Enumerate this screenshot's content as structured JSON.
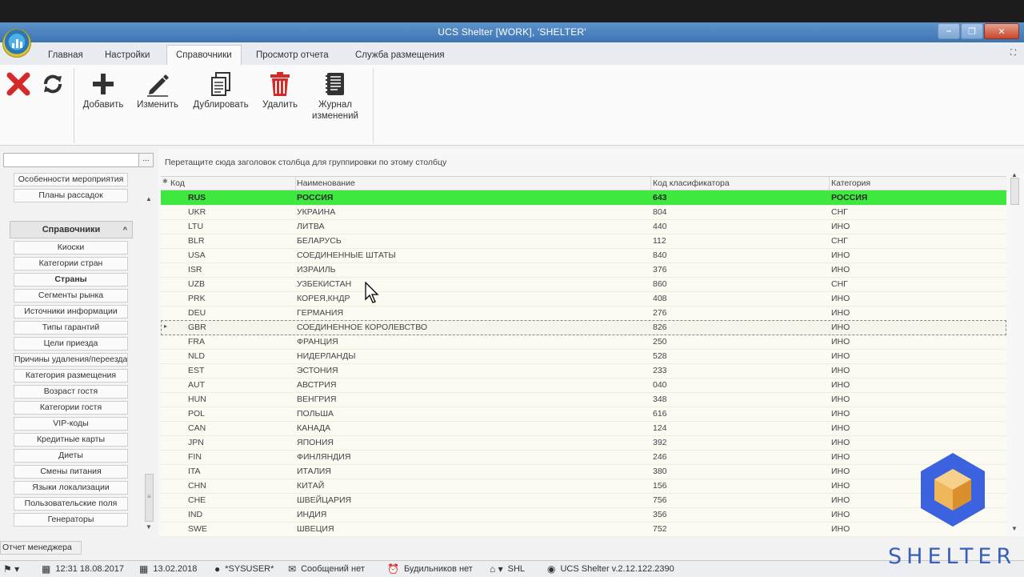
{
  "window": {
    "title": "UCS Shelter [WORK], 'SHELTER'"
  },
  "menu_tabs": [
    {
      "label": "Главная"
    },
    {
      "label": "Настройки"
    },
    {
      "label": "Справочники",
      "active": true
    },
    {
      "label": "Просмотр отчета"
    },
    {
      "label": "Служба размещения"
    }
  ],
  "ribbon": {
    "buttons": [
      {
        "label": "Добавить",
        "icon": "plus-icon"
      },
      {
        "label": "Изменить",
        "icon": "pencil-icon"
      },
      {
        "label": "Дублировать",
        "icon": "duplicate-icon"
      },
      {
        "label": "Удалить",
        "icon": "trash-icon"
      },
      {
        "label": "Журнал изменений",
        "icon": "journal-icon"
      }
    ],
    "leading_icons": [
      "close-x-icon",
      "refresh-icon"
    ]
  },
  "left_panel": {
    "search_value": "",
    "search_button": "...",
    "top_items": [
      {
        "label": "Особенности мероприятия"
      },
      {
        "label": "Планы рассадок"
      }
    ],
    "group": {
      "label": "Справочники",
      "caret": "^"
    },
    "items": [
      {
        "label": "Киоски"
      },
      {
        "label": "Категории стран"
      },
      {
        "label": "Страны",
        "selected": true
      },
      {
        "label": "Сегменты рынка"
      },
      {
        "label": "Источники информации"
      },
      {
        "label": "Типы гарантий"
      },
      {
        "label": "Цели приезда"
      },
      {
        "label": "Причины удаления/переезда"
      },
      {
        "label": "Категория размещения"
      },
      {
        "label": "Возраст гостя"
      },
      {
        "label": "Категории гостя"
      },
      {
        "label": "VIP-коды"
      },
      {
        "label": "Кредитные карты"
      },
      {
        "label": "Диеты"
      },
      {
        "label": "Смены питания"
      },
      {
        "label": "Языки локализации"
      },
      {
        "label": "Пользовательские поля"
      },
      {
        "label": "Генераторы"
      }
    ]
  },
  "grid": {
    "group_hint": "Перетащите сюда заголовок столбца для группировки по этому столбцу",
    "columns": [
      "Код",
      "Наименование",
      "Код класификатора",
      "Категория"
    ],
    "rows": [
      {
        "code": "RUS",
        "name": "РОССИЯ",
        "classifier": "643",
        "category": "РОССИЯ",
        "highlight": true
      },
      {
        "code": "UKR",
        "name": "УКРАИНА",
        "classifier": "804",
        "category": "СНГ"
      },
      {
        "code": "LTU",
        "name": "ЛИТВА",
        "classifier": "440",
        "category": "ИНО"
      },
      {
        "code": "BLR",
        "name": "БЕЛАРУСЬ",
        "classifier": "112",
        "category": "СНГ"
      },
      {
        "code": "USA",
        "name": "СОЕДИНЕННЫЕ ШТАТЫ",
        "classifier": "840",
        "category": "ИНО"
      },
      {
        "code": "ISR",
        "name": "ИЗРАИЛЬ",
        "classifier": "376",
        "category": "ИНО"
      },
      {
        "code": "UZB",
        "name": "УЗБЕКИСТАН",
        "classifier": "860",
        "category": "СНГ"
      },
      {
        "code": "PRK",
        "name": "КОРЕЯ,КНДР",
        "classifier": "408",
        "category": "ИНО"
      },
      {
        "code": "DEU",
        "name": "ГЕРМАНИЯ",
        "classifier": "276",
        "category": "ИНО"
      },
      {
        "code": "GBR",
        "name": "СОЕДИНЕННОЕ КОРОЛЕВСТВО",
        "classifier": "826",
        "category": "ИНО",
        "focused": true
      },
      {
        "code": "FRA",
        "name": "ФРАНЦИЯ",
        "classifier": "250",
        "category": "ИНО"
      },
      {
        "code": "NLD",
        "name": "НИДЕРЛАНДЫ",
        "classifier": "528",
        "category": "ИНО"
      },
      {
        "code": "EST",
        "name": "ЭСТОНИЯ",
        "classifier": "233",
        "category": "ИНО"
      },
      {
        "code": "AUT",
        "name": "АВСТРИЯ",
        "classifier": "040",
        "category": "ИНО"
      },
      {
        "code": "HUN",
        "name": "ВЕНГРИЯ",
        "classifier": "348",
        "category": "ИНО"
      },
      {
        "code": "POL",
        "name": "ПОЛЬША",
        "classifier": "616",
        "category": "ИНО"
      },
      {
        "code": "CAN",
        "name": "КАНАДА",
        "classifier": "124",
        "category": "ИНО"
      },
      {
        "code": "JPN",
        "name": "ЯПОНИЯ",
        "classifier": "392",
        "category": "ИНО"
      },
      {
        "code": "FIN",
        "name": "ФИНЛЯНДИЯ",
        "classifier": "246",
        "category": "ИНО"
      },
      {
        "code": "ITA",
        "name": "ИТАЛИЯ",
        "classifier": "380",
        "category": "ИНО"
      },
      {
        "code": "CHN",
        "name": "КИТАЙ",
        "classifier": "156",
        "category": "ИНО"
      },
      {
        "code": "CHE",
        "name": "ШВЕЙЦАРИЯ",
        "classifier": "756",
        "category": "ИНО"
      },
      {
        "code": "IND",
        "name": "ИНДИЯ",
        "classifier": "356",
        "category": "ИНО"
      },
      {
        "code": "SWE",
        "name": "ШВЕЦИЯ",
        "classifier": "752",
        "category": "ИНО"
      }
    ]
  },
  "manager_tab": "Отчет менеджера",
  "status_bar": {
    "datetime": "12:31 18.08.2017",
    "date": "13.02.2018",
    "user": "*SYSUSER*",
    "messages": "Сообщений нет",
    "alarms": "Будильников нет",
    "hotel": "SHL",
    "version": "UCS Shelter v.2.12.122.2390"
  },
  "brand": {
    "word": "SHELTER"
  },
  "colors": {
    "titlebar": "#3d74b3",
    "highlight_row": "#3ee83e",
    "delete_red": "#d42a2a",
    "brand_blue": "#3a5fb8"
  }
}
